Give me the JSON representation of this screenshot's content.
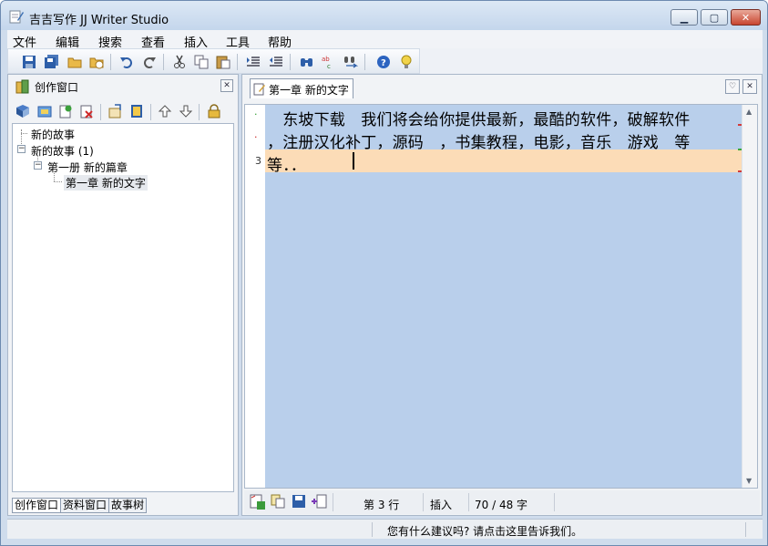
{
  "window": {
    "title": "吉吉写作 JJ Writer Studio"
  },
  "menu": [
    "文件",
    "编辑",
    "搜索",
    "查看",
    "插入",
    "工具",
    "帮助"
  ],
  "toolbar": {
    "icons": [
      "save-icon",
      "save-all-icon",
      "open-icon",
      "open-recent-icon",
      "undo-icon",
      "redo-icon",
      "cut-icon",
      "copy-icon",
      "paste-icon",
      "indent-icon",
      "outdent-icon",
      "find-icon",
      "spell-check-icon",
      "replace-icon",
      "help-icon",
      "tip-icon"
    ]
  },
  "left_panel": {
    "title": "创作窗口",
    "tree": {
      "items": [
        {
          "label": "新的故事"
        },
        {
          "label": "新的故事 (1)"
        },
        {
          "label": "第一册 新的篇章"
        },
        {
          "label": "第一章 新的文字"
        }
      ]
    },
    "tabs": [
      "创作窗口",
      "资料窗口",
      "故事树"
    ]
  },
  "editor": {
    "tab_label": "第一章 新的文字",
    "lines": [
      "　东坡下载　我们将会给你提供最新，最酷的软件，破解软件",
      "，注册汉化补丁，源码　，书集教程，电影，音乐　游戏　等",
      "等．．"
    ],
    "line_number": "3",
    "status": {
      "line": "第 3 行",
      "mode": "插入",
      "count": "70 / 48 字"
    }
  },
  "bottom_bar": {
    "feedback": "您有什么建议吗? 请点击这里告诉我们。"
  },
  "colors": {
    "text_bg": "#b9cfeb",
    "current_line": "#fcdcb7",
    "window_chrome": "#cfdcec"
  }
}
